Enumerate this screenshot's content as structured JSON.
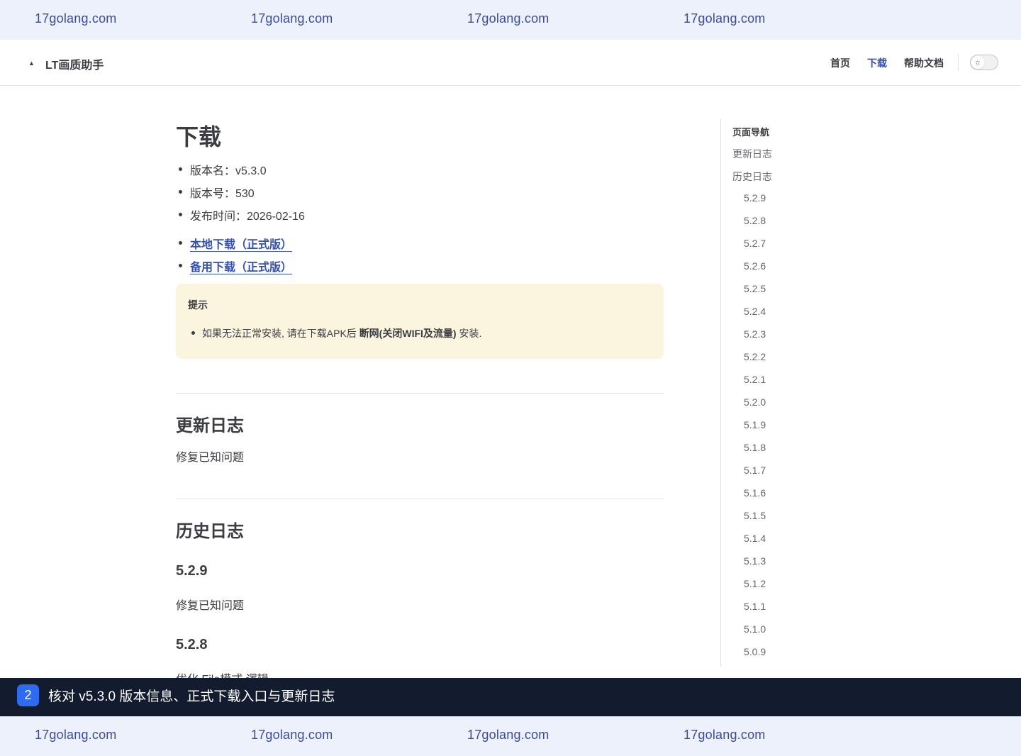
{
  "banner": {
    "text": "17golang.com"
  },
  "nav": {
    "site_title": "LT画质助手",
    "links": [
      "首页",
      "下载",
      "帮助文档"
    ],
    "active": "下载"
  },
  "content": {
    "title": "下载",
    "info": [
      "版本名：v5.3.0",
      "版本号：530",
      "发布时间：2026-02-16"
    ],
    "downloads": [
      "本地下载（正式版）",
      "备用下载（正式版）"
    ],
    "tip": {
      "title": "提示",
      "text_before": "如果无法正常安装, 请在下载APK后 ",
      "text_bold": "断网(关闭WIFI及流量)",
      "text_after": " 安装."
    },
    "changelog": {
      "heading": "更新日志",
      "text": "修复已知问题"
    },
    "history": {
      "heading": "历史日志",
      "entries": [
        {
          "version": "5.2.9",
          "text": "修复已知问题"
        },
        {
          "version": "5.2.8",
          "text": "优化 File模式 逻辑"
        }
      ]
    }
  },
  "toc": {
    "title": "页面导航",
    "top_items": [
      "更新日志",
      "历史日志"
    ],
    "versions": [
      "5.2.9",
      "5.2.8",
      "5.2.7",
      "5.2.6",
      "5.2.5",
      "5.2.4",
      "5.2.3",
      "5.2.2",
      "5.2.1",
      "5.2.0",
      "5.1.9",
      "5.1.8",
      "5.1.7",
      "5.1.6",
      "5.1.5",
      "5.1.4",
      "5.1.3",
      "5.1.2",
      "5.1.1",
      "5.1.0",
      "5.0.9"
    ]
  },
  "step": {
    "number": "2",
    "text": "核对 v5.3.0 版本信息、正式下载入口与更新日志"
  },
  "colors": {
    "accent": "#3451b2",
    "tip_bg": "#fbf5df",
    "banner_bg": "#edf1fc",
    "step_bar": "#131b2e",
    "step_badge": "#2f6bf0"
  }
}
